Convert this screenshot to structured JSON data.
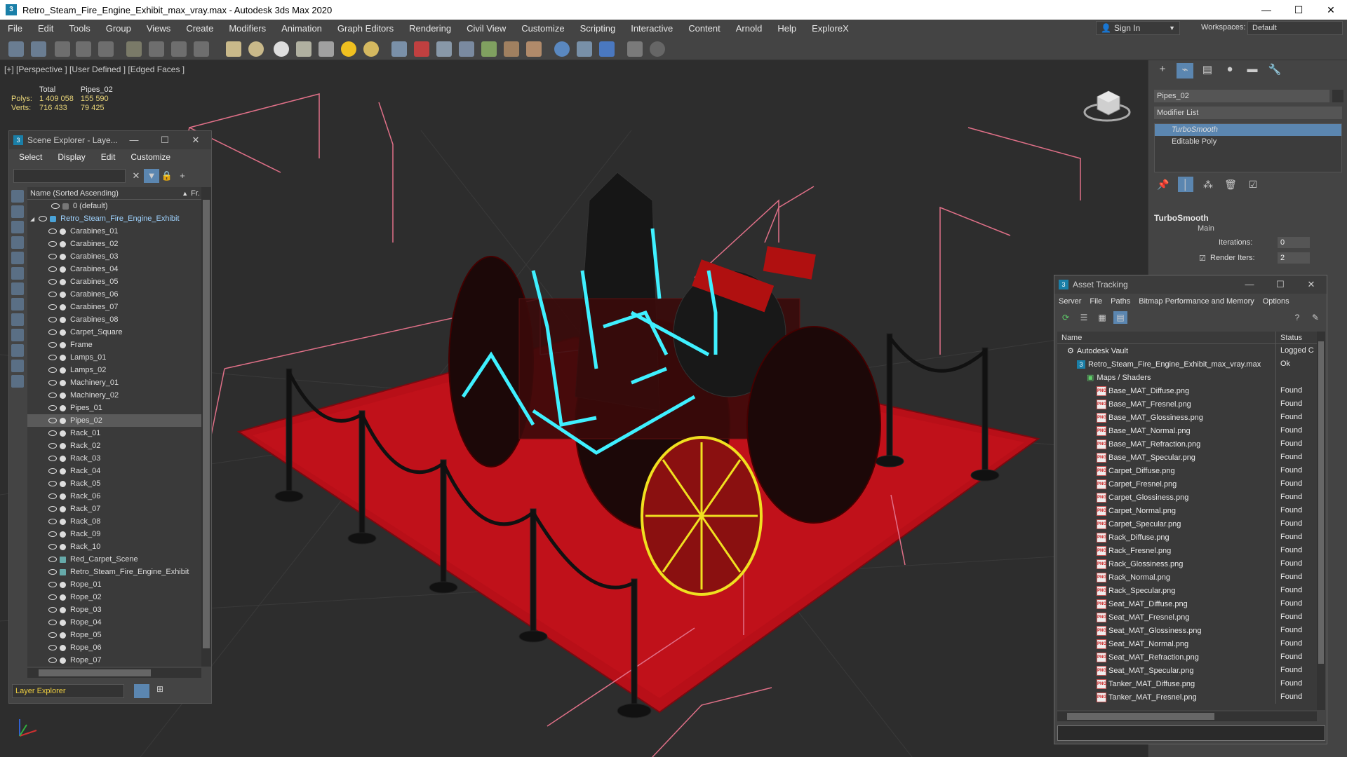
{
  "window": {
    "title": "Retro_Steam_Fire_Engine_Exhibit_max_vray.max - Autodesk 3ds Max 2020",
    "minimize": "—",
    "maximize": "☐",
    "close": "✕"
  },
  "menu": [
    "File",
    "Edit",
    "Tools",
    "Group",
    "Views",
    "Create",
    "Modifiers",
    "Animation",
    "Graph Editors",
    "Rendering",
    "Civil View",
    "Customize",
    "Scripting",
    "Interactive",
    "Content",
    "Arnold",
    "Help",
    "ExploreX"
  ],
  "signin": "Sign In",
  "workspaces": {
    "label": "Workspaces:",
    "value": "Default"
  },
  "viewport": {
    "label": "[+] [Perspective ] [User Defined ] [Edged Faces ]",
    "stats": {
      "col1": "Total",
      "col2": "Pipes_02",
      "polys_label": "Polys:",
      "polys_total": "1 409 058",
      "polys_sel": "155 590",
      "verts_label": "Verts:",
      "verts_total": "716 433",
      "verts_sel": "79 425"
    }
  },
  "scene_explorer": {
    "title": "Scene Explorer - Laye...",
    "menu": [
      "Select",
      "Display",
      "Edit",
      "Customize"
    ],
    "column": "Name (Sorted Ascending)",
    "column2": "Fr.",
    "footer": "Layer Explorer",
    "rows": [
      {
        "name": "0 (default)",
        "type": "layer0"
      },
      {
        "name": "Retro_Steam_Fire_Engine_Exhibit",
        "type": "layer"
      },
      {
        "name": "Carabines_01",
        "type": "obj"
      },
      {
        "name": "Carabines_02",
        "type": "obj"
      },
      {
        "name": "Carabines_03",
        "type": "obj"
      },
      {
        "name": "Carabines_04",
        "type": "obj"
      },
      {
        "name": "Carabines_05",
        "type": "obj"
      },
      {
        "name": "Carabines_06",
        "type": "obj"
      },
      {
        "name": "Carabines_07",
        "type": "obj"
      },
      {
        "name": "Carabines_08",
        "type": "obj"
      },
      {
        "name": "Carpet_Square",
        "type": "obj"
      },
      {
        "name": "Frame",
        "type": "obj"
      },
      {
        "name": "Lamps_01",
        "type": "obj"
      },
      {
        "name": "Lamps_02",
        "type": "obj"
      },
      {
        "name": "Machinery_01",
        "type": "obj"
      },
      {
        "name": "Machinery_02",
        "type": "obj"
      },
      {
        "name": "Pipes_01",
        "type": "obj"
      },
      {
        "name": "Pipes_02",
        "type": "sel"
      },
      {
        "name": "Rack_01",
        "type": "obj"
      },
      {
        "name": "Rack_02",
        "type": "obj"
      },
      {
        "name": "Rack_03",
        "type": "obj"
      },
      {
        "name": "Rack_04",
        "type": "obj"
      },
      {
        "name": "Rack_05",
        "type": "obj"
      },
      {
        "name": "Rack_06",
        "type": "obj"
      },
      {
        "name": "Rack_07",
        "type": "obj"
      },
      {
        "name": "Rack_08",
        "type": "obj"
      },
      {
        "name": "Rack_09",
        "type": "obj"
      },
      {
        "name": "Rack_10",
        "type": "obj"
      },
      {
        "name": "Red_Carpet_Scene",
        "type": "group"
      },
      {
        "name": "Retro_Steam_Fire_Engine_Exhibit",
        "type": "group"
      },
      {
        "name": "Rope_01",
        "type": "obj"
      },
      {
        "name": "Rope_02",
        "type": "obj"
      },
      {
        "name": "Rope_03",
        "type": "obj"
      },
      {
        "name": "Rope_04",
        "type": "obj"
      },
      {
        "name": "Rope_05",
        "type": "obj"
      },
      {
        "name": "Rope_06",
        "type": "obj"
      },
      {
        "name": "Rope_07",
        "type": "obj"
      }
    ]
  },
  "command_panel": {
    "object_name": "Pipes_02",
    "modifier_list": "Modifier List",
    "stack": [
      "TurboSmooth",
      "Editable Poly"
    ],
    "rollout": "TurboSmooth",
    "main": "Main",
    "iterations_label": "Iterations:",
    "iterations": "0",
    "render_iters_label": "Render Iters:",
    "render_iters": "2"
  },
  "asset_tracking": {
    "title": "Asset Tracking",
    "menu": [
      "Server",
      "File",
      "Paths",
      "Bitmap Performance and Memory",
      "Options"
    ],
    "col_name": "Name",
    "col_status": "Status",
    "rows": [
      {
        "name": "Autodesk Vault",
        "status": "Logged C",
        "indent": 1,
        "kind": "vault"
      },
      {
        "name": "Retro_Steam_Fire_Engine_Exhibit_max_vray.max",
        "status": "Ok",
        "indent": 2,
        "kind": "max"
      },
      {
        "name": "Maps / Shaders",
        "status": "",
        "indent": 3,
        "kind": "maps"
      },
      {
        "name": "Base_MAT_Diffuse.png",
        "status": "Found",
        "indent": 4,
        "kind": "png"
      },
      {
        "name": "Base_MAT_Fresnel.png",
        "status": "Found",
        "indent": 4,
        "kind": "png"
      },
      {
        "name": "Base_MAT_Glossiness.png",
        "status": "Found",
        "indent": 4,
        "kind": "png"
      },
      {
        "name": "Base_MAT_Normal.png",
        "status": "Found",
        "indent": 4,
        "kind": "png"
      },
      {
        "name": "Base_MAT_Refraction.png",
        "status": "Found",
        "indent": 4,
        "kind": "png"
      },
      {
        "name": "Base_MAT_Specular.png",
        "status": "Found",
        "indent": 4,
        "kind": "png"
      },
      {
        "name": "Carpet_Diffuse.png",
        "status": "Found",
        "indent": 4,
        "kind": "png"
      },
      {
        "name": "Carpet_Fresnel.png",
        "status": "Found",
        "indent": 4,
        "kind": "png"
      },
      {
        "name": "Carpet_Glossiness.png",
        "status": "Found",
        "indent": 4,
        "kind": "png"
      },
      {
        "name": "Carpet_Normal.png",
        "status": "Found",
        "indent": 4,
        "kind": "png"
      },
      {
        "name": "Carpet_Specular.png",
        "status": "Found",
        "indent": 4,
        "kind": "png"
      },
      {
        "name": "Rack_Diffuse.png",
        "status": "Found",
        "indent": 4,
        "kind": "png"
      },
      {
        "name": "Rack_Fresnel.png",
        "status": "Found",
        "indent": 4,
        "kind": "png"
      },
      {
        "name": "Rack_Glossiness.png",
        "status": "Found",
        "indent": 4,
        "kind": "png"
      },
      {
        "name": "Rack_Normal.png",
        "status": "Found",
        "indent": 4,
        "kind": "png"
      },
      {
        "name": "Rack_Specular.png",
        "status": "Found",
        "indent": 4,
        "kind": "png"
      },
      {
        "name": "Seat_MAT_Diffuse.png",
        "status": "Found",
        "indent": 4,
        "kind": "png"
      },
      {
        "name": "Seat_MAT_Fresnel.png",
        "status": "Found",
        "indent": 4,
        "kind": "png"
      },
      {
        "name": "Seat_MAT_Glossiness.png",
        "status": "Found",
        "indent": 4,
        "kind": "png"
      },
      {
        "name": "Seat_MAT_Normal.png",
        "status": "Found",
        "indent": 4,
        "kind": "png"
      },
      {
        "name": "Seat_MAT_Refraction.png",
        "status": "Found",
        "indent": 4,
        "kind": "png"
      },
      {
        "name": "Seat_MAT_Specular.png",
        "status": "Found",
        "indent": 4,
        "kind": "png"
      },
      {
        "name": "Tanker_MAT_Diffuse.png",
        "status": "Found",
        "indent": 4,
        "kind": "png"
      },
      {
        "name": "Tanker_MAT_Fresnel.png",
        "status": "Found",
        "indent": 4,
        "kind": "png"
      }
    ]
  },
  "colors": {
    "carpet": "#c0101a",
    "selection": "#3ff0ff",
    "wheel_highlight": "#f0e020",
    "bbox": "#e07088"
  }
}
